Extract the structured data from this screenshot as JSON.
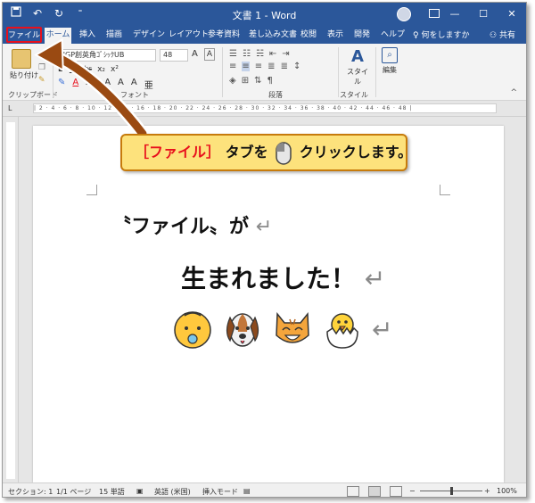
{
  "titlebar": {
    "document_title": "文書 1 - Word",
    "qat_icons": [
      "save-icon",
      "undo-icon",
      "redo-icon",
      "customize-icon"
    ],
    "window_controls": [
      "minimize-icon",
      "maximize-icon",
      "close-icon"
    ]
  },
  "tabs": {
    "file": "ファイル",
    "home": "ホーム",
    "insert": "挿入",
    "draw": "描画",
    "design": "デザイン",
    "layout": "レイアウト",
    "references": "参考資料",
    "mailings": "差し込み文書",
    "review": "校閲",
    "view": "表示",
    "developer": "開発",
    "help": "ヘルプ",
    "tell_me": "何をしますか",
    "share": "共有"
  },
  "ribbon": {
    "paste_label": "貼り付け",
    "clipboard_label": "クリップボード",
    "font_label": "フォント",
    "paragraph_label": "段落",
    "styles_label": "スタイル",
    "styles_button": "スタイル",
    "editing_button": "編集",
    "font_name": "HGP創英角ｺﾞｼｯｸUB",
    "font_size": "48"
  },
  "document": {
    "line1": "〝ファイル〟が",
    "line2": "生まれました！",
    "return_mark": "↵",
    "emojis": [
      "baby-face-emoji",
      "dog-face-emoji",
      "cat-face-emoji",
      "hatching-chick-emoji"
    ]
  },
  "callout": {
    "prefix": "［ファイル］",
    "middle": "タブを",
    "suffix": "クリックします。"
  },
  "statusbar": {
    "section": "セクション: 1",
    "page": "1/1 ページ",
    "words": "15 単語",
    "language": "英語 (米国)",
    "mode": "挿入モード",
    "zoom": "100%"
  },
  "colors": {
    "word_blue": "#2b579a",
    "highlight_red": "#e8101c",
    "callout_fill": "#fde27c",
    "arrow_brown": "#9a4a12"
  }
}
